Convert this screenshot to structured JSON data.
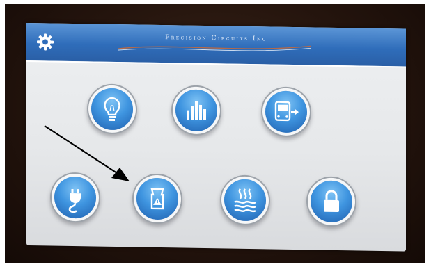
{
  "header": {
    "title": "Precision Circuits Inc"
  },
  "icons": {
    "settings": "gear-icon",
    "row1": [
      "lightbulb-icon",
      "bar-chart-icon",
      "bus-exit-icon"
    ],
    "row2": [
      "power-plug-icon",
      "warning-sign-icon",
      "heat-waves-icon",
      "lock-icon"
    ]
  },
  "colors": {
    "header": "#2f6dba",
    "button": "#3f95e0",
    "screen": "#e6e8ea",
    "bezel": "#24140d"
  }
}
